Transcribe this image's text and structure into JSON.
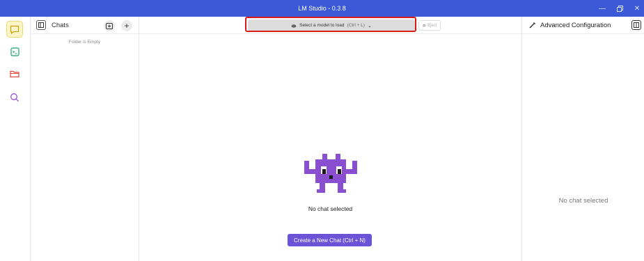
{
  "window": {
    "title": "LM Studio - 0.3.8"
  },
  "colors": {
    "accent": "#6b53d8",
    "titlebar": "#3c5ad8",
    "highlight": "#d71a1a"
  },
  "iconbar": {
    "items": [
      {
        "name": "chat-icon",
        "active": true
      },
      {
        "name": "terminal-icon",
        "active": false
      },
      {
        "name": "folder-icon",
        "active": false
      },
      {
        "name": "search-icon",
        "active": false
      }
    ]
  },
  "chats_panel": {
    "title": "Chats",
    "empty_text": "Folder is Empty"
  },
  "topbar": {
    "model_select": "Select a model to load",
    "shortcut": "(Ctrl + L)",
    "eject": "Eject"
  },
  "main": {
    "empty_text": "No chat selected",
    "new_chat_label": "Create a New Chat (Ctrl + N)"
  },
  "right_panel": {
    "title": "Advanced Configuration",
    "empty_text": "No chat selected"
  }
}
